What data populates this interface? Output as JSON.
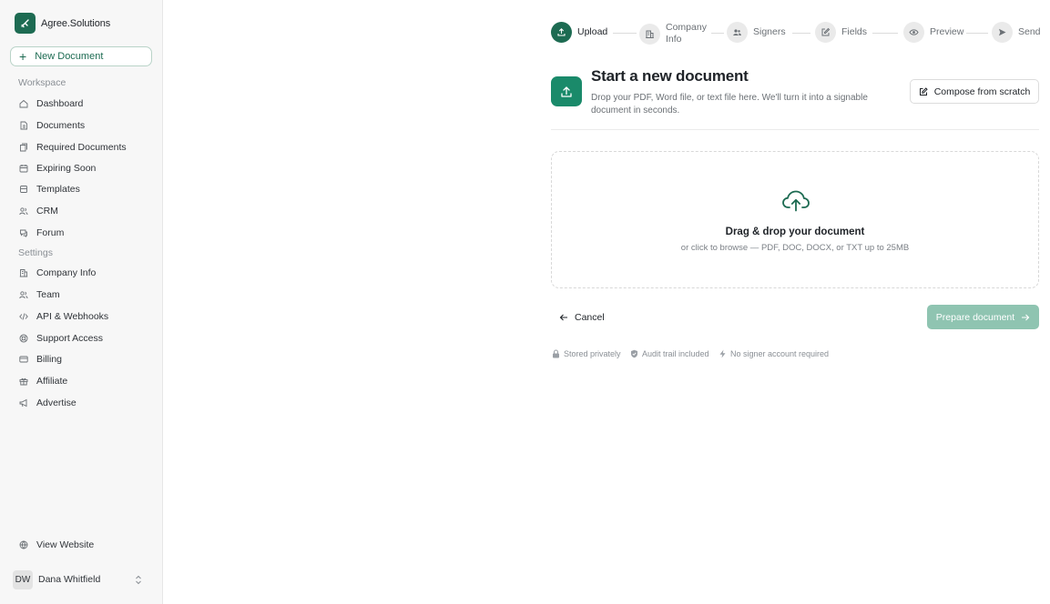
{
  "brand": {
    "name": "Agree.Solutions"
  },
  "sidebar": {
    "new_document": "New Document",
    "workspace_label": "Workspace",
    "settings_label": "Settings",
    "workspace_items": [
      {
        "label": "Dashboard",
        "icon": "home-icon"
      },
      {
        "label": "Documents",
        "icon": "document-icon"
      },
      {
        "label": "Required Documents",
        "icon": "documents-stack-icon"
      },
      {
        "label": "Expiring Soon",
        "icon": "calendar-icon"
      },
      {
        "label": "Templates",
        "icon": "template-icon"
      },
      {
        "label": "CRM",
        "icon": "users-icon"
      },
      {
        "label": "Forum",
        "icon": "chat-icon"
      }
    ],
    "settings_items": [
      {
        "label": "Company Info",
        "icon": "building-icon"
      },
      {
        "label": "Team",
        "icon": "users-icon"
      },
      {
        "label": "API & Webhooks",
        "icon": "code-icon"
      },
      {
        "label": "Support Access",
        "icon": "lifebuoy-icon"
      },
      {
        "label": "Billing",
        "icon": "credit-card-icon"
      },
      {
        "label": "Affiliate",
        "icon": "gift-icon"
      },
      {
        "label": "Advertise",
        "icon": "megaphone-icon"
      }
    ],
    "view_website": "View Website",
    "user": {
      "initials": "DW",
      "name": "Dana Whitfield"
    }
  },
  "stepper": {
    "steps": [
      {
        "label": "Upload",
        "active": true,
        "icon": "upload-icon"
      },
      {
        "label": "Company Info",
        "line1": "Company",
        "line2": "Info",
        "active": false,
        "icon": "building-icon"
      },
      {
        "label": "Signers",
        "active": false,
        "icon": "users-icon"
      },
      {
        "label": "Fields",
        "active": false,
        "icon": "edit-icon"
      },
      {
        "label": "Preview",
        "active": false,
        "icon": "eye-icon"
      },
      {
        "label": "Send",
        "active": false,
        "icon": "send-icon"
      }
    ]
  },
  "main": {
    "title": "Start a new document",
    "subtitle": "Drop your PDF, Word file, or text file here. We'll turn it into a signable document in seconds.",
    "compose_button": "Compose from scratch",
    "dropzone": {
      "title": "Drag & drop your document",
      "subtitle": "or click to browse — PDF, DOC, DOCX, or TXT up to 25MB",
      "icon": "cloud-upload-icon"
    },
    "cancel_button": "Cancel",
    "prepare_button": "Prepare document",
    "badges": [
      {
        "label": "Stored privately",
        "icon": "lock-icon"
      },
      {
        "label": "Audit trail included",
        "icon": "shield-check-icon"
      },
      {
        "label": "No signer account required",
        "icon": "bolt-icon"
      }
    ]
  },
  "colors": {
    "brand": "#1d6b52",
    "accent": "#1a8a6a",
    "disabled_button": "#8fc4b1"
  }
}
